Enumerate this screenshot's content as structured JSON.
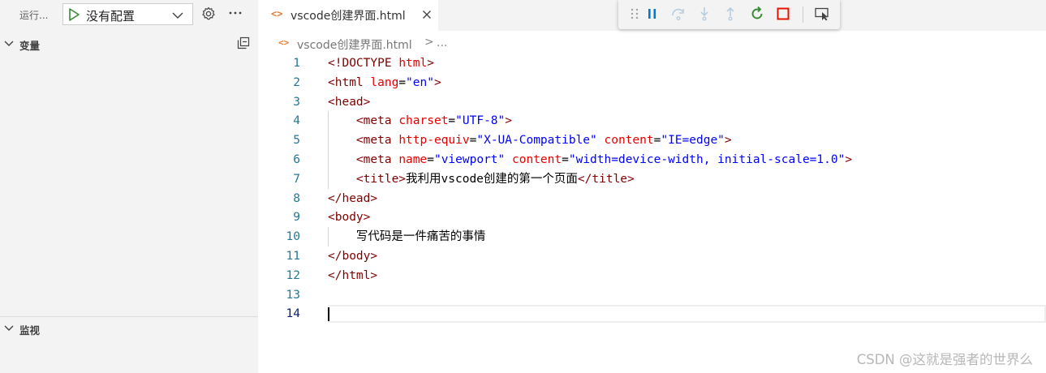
{
  "run_toolbar": {
    "run_label": "运行...",
    "config_selected": "没有配置"
  },
  "sidebar": {
    "variables_title": "变量",
    "watch_title": "监视"
  },
  "tab": {
    "label": "vscode创建界面.html"
  },
  "breadcrumb": {
    "file": "vscode创建界面.html",
    "separator": ">",
    "more": "..."
  },
  "code_lines": [
    [
      [
        "tag",
        "<!DOCTYPE "
      ],
      [
        "attr",
        "html"
      ],
      [
        "tag",
        ">"
      ]
    ],
    [
      [
        "tag",
        "<html "
      ],
      [
        "attr",
        "lang"
      ],
      [
        "text",
        "="
      ],
      [
        "str",
        "\"en\""
      ],
      [
        "tag",
        ">"
      ]
    ],
    [
      [
        "tag",
        "<head>"
      ]
    ],
    [
      [
        "text",
        "    "
      ],
      [
        "tag",
        "<meta "
      ],
      [
        "attr",
        "charset"
      ],
      [
        "text",
        "="
      ],
      [
        "str",
        "\"UTF-8\""
      ],
      [
        "tag",
        ">"
      ]
    ],
    [
      [
        "text",
        "    "
      ],
      [
        "tag",
        "<meta "
      ],
      [
        "attr",
        "http-equiv"
      ],
      [
        "text",
        "="
      ],
      [
        "str",
        "\"X-UA-Compatible\""
      ],
      [
        "text",
        " "
      ],
      [
        "attr",
        "content"
      ],
      [
        "text",
        "="
      ],
      [
        "str",
        "\"IE=edge\""
      ],
      [
        "tag",
        ">"
      ]
    ],
    [
      [
        "text",
        "    "
      ],
      [
        "tag",
        "<meta "
      ],
      [
        "attr",
        "name"
      ],
      [
        "text",
        "="
      ],
      [
        "str",
        "\"viewport\""
      ],
      [
        "text",
        " "
      ],
      [
        "attr",
        "content"
      ],
      [
        "text",
        "="
      ],
      [
        "str",
        "\"width=device-width, initial-scale=1.0\""
      ],
      [
        "tag",
        ">"
      ]
    ],
    [
      [
        "text",
        "    "
      ],
      [
        "tag",
        "<title>"
      ],
      [
        "text",
        "我利用vscode创建的第一个页面"
      ],
      [
        "tag",
        "</title>"
      ]
    ],
    [
      [
        "tag",
        "</head>"
      ]
    ],
    [
      [
        "tag",
        "<body>"
      ]
    ],
    [
      [
        "text",
        "    写代码是一件痛苦的事情"
      ]
    ],
    [
      [
        "tag",
        "</body>"
      ]
    ],
    [
      [
        "tag",
        "</html>"
      ]
    ],
    [],
    []
  ],
  "line_numbers": [
    "1",
    "2",
    "3",
    "4",
    "5",
    "6",
    "7",
    "8",
    "9",
    "10",
    "11",
    "12",
    "13",
    "14"
  ],
  "active_line": 14,
  "colors": {
    "tag": "#800000",
    "attr": "#e50000",
    "string": "#0000ff",
    "line_number": "#237893",
    "run_icon": "#388a34",
    "restart_icon": "#388a34",
    "stop_icon": "#e51400",
    "pause_icon": "#007acc"
  },
  "icons": [
    "play-icon",
    "chevron-down-icon",
    "gear-icon",
    "more-icon",
    "collapse-all-icon",
    "html-file-icon",
    "close-icon",
    "drag-grip-icon",
    "pause-icon",
    "step-over-icon",
    "step-into-icon",
    "step-out-icon",
    "restart-icon",
    "stop-icon",
    "inspect-icon"
  ],
  "watermark": "CSDN @这就是强者的世界么"
}
